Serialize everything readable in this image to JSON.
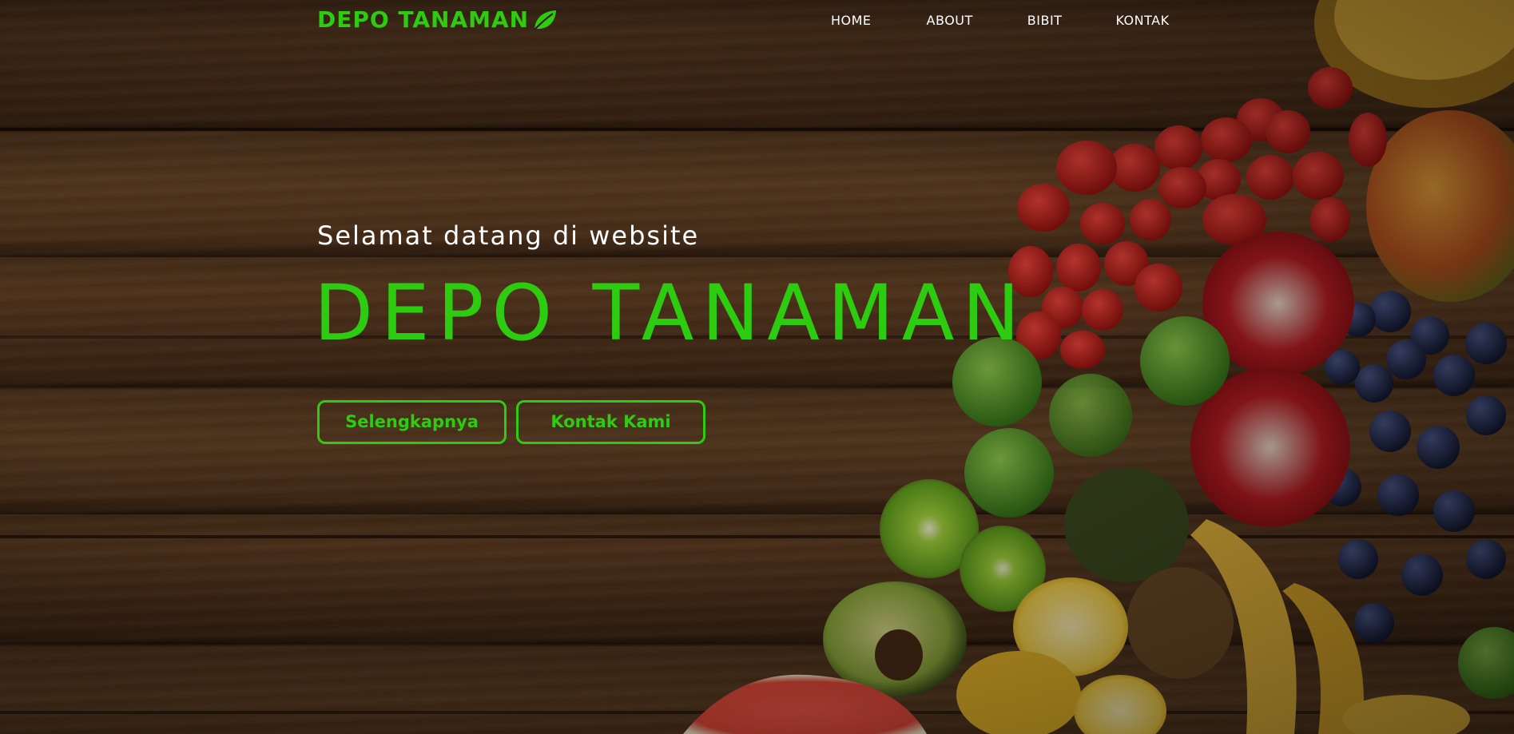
{
  "brand": {
    "name": "DEPO TANAMAN",
    "color": "#2ecc11",
    "icon": "leaf-icon"
  },
  "nav": {
    "items": [
      {
        "label": "HOME"
      },
      {
        "label": "ABOUT"
      },
      {
        "label": "BIBIT"
      },
      {
        "label": "KONTAK"
      }
    ]
  },
  "hero": {
    "welcome": "Selamat datang di website",
    "headline": "DEPO TANAMAN",
    "buttons": {
      "more_label": "Selengkapnya",
      "contact_label": "Kontak Kami"
    },
    "background": "wooden-table-with-fruits"
  },
  "colors": {
    "accent": "#2ecc11",
    "text": "#ffffff"
  }
}
